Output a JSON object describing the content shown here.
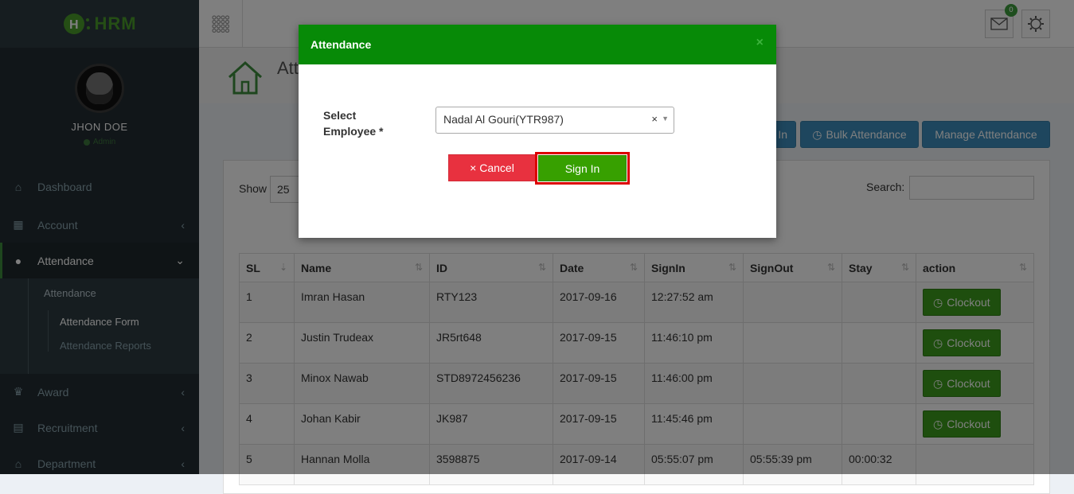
{
  "app": {
    "logo": "HRM"
  },
  "user": {
    "name": "JHON DOE",
    "role": "Admin"
  },
  "sidebar": {
    "items": [
      {
        "label": "Dashboard",
        "icon": "home-icon"
      },
      {
        "label": "Account",
        "icon": "calculator-icon"
      },
      {
        "label": "Attendance",
        "icon": "user-icon"
      },
      {
        "label": "Award",
        "icon": "trophy-icon"
      },
      {
        "label": "Recruitment",
        "icon": "keyboard-icon"
      },
      {
        "label": "Department",
        "icon": "bank-icon"
      }
    ],
    "sub": {
      "group": "Attendance",
      "form": "Attendance Form",
      "reports": "Attendance Reports"
    }
  },
  "topbar": {
    "mail_count": "0"
  },
  "page": {
    "title": "Attendance"
  },
  "actions": {
    "signin": "In",
    "bulk": "Bulk Attendance",
    "manage": "Manage Atttendance"
  },
  "table_controls": {
    "show_label": "Show",
    "show_value": "25",
    "search_label": "Search:"
  },
  "table": {
    "headers": [
      "SL",
      "Name",
      "ID",
      "Date",
      "SignIn",
      "SignOut",
      "Stay",
      "action"
    ],
    "rows": [
      {
        "sl": "1",
        "name": "Imran Hasan",
        "id": "RTY123",
        "date": "2017-09-16",
        "signin": "12:27:52 am",
        "signout": "",
        "stay": "",
        "action": "Clockout"
      },
      {
        "sl": "2",
        "name": "Justin Trudeax",
        "id": "JR5rt648",
        "date": "2017-09-15",
        "signin": "11:46:10 pm",
        "signout": "",
        "stay": "",
        "action": "Clockout"
      },
      {
        "sl": "3",
        "name": "Minox Nawab",
        "id": "STD8972456236",
        "date": "2017-09-15",
        "signin": "11:46:00 pm",
        "signout": "",
        "stay": "",
        "action": "Clockout"
      },
      {
        "sl": "4",
        "name": "Johan Kabir",
        "id": "JK987",
        "date": "2017-09-15",
        "signin": "11:45:46 pm",
        "signout": "",
        "stay": "",
        "action": "Clockout"
      },
      {
        "sl": "5",
        "name": "Hannan Molla",
        "id": "3598875",
        "date": "2017-09-14",
        "signin": "05:55:07 pm",
        "signout": "05:55:39 pm",
        "stay": "00:00:32",
        "action": ""
      }
    ]
  },
  "modal": {
    "title": "Attendance",
    "close": "×",
    "label_line1": "Select",
    "label_line2": "Employee *",
    "selected": "Nadal Al Gouri(YTR987)",
    "clear": "×",
    "cancel": "× Cancel",
    "signin": "Sign In"
  },
  "colors": {
    "header": "#078a07",
    "signin": "#37a000",
    "cancel": "#e8313f",
    "blue": "#3c8dbc",
    "sidebar": "#222d32"
  }
}
